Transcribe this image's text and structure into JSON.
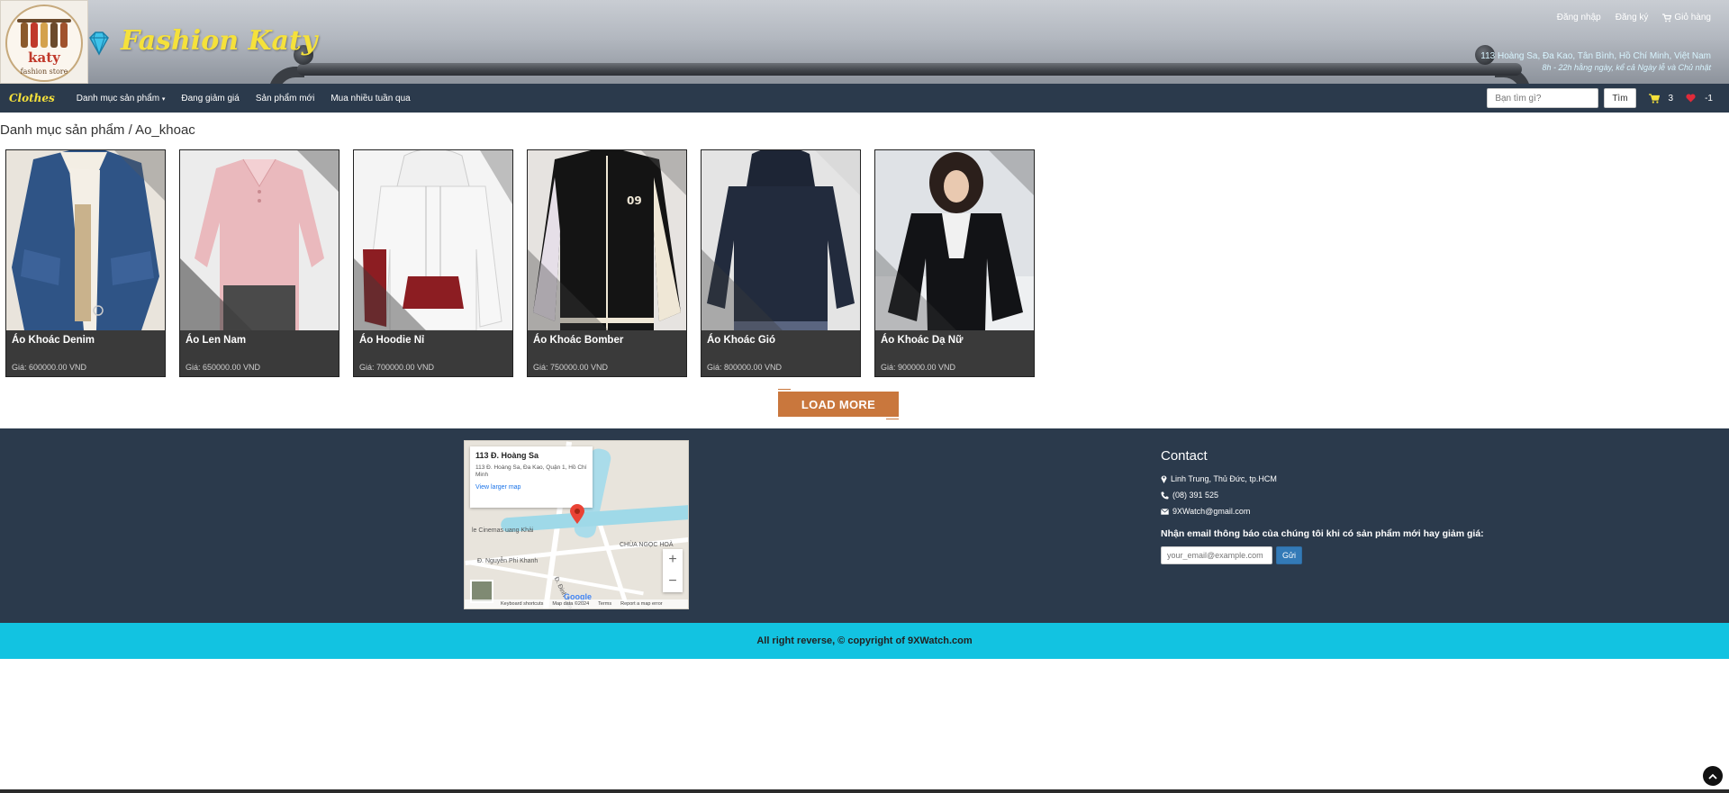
{
  "header": {
    "logo_word": "katy",
    "logo_sub": "fashion store",
    "brand_name": "Fashion Katy",
    "links": {
      "login": "Đăng nhập",
      "register": "Đăng ký",
      "cart": "Giỏ hàng"
    },
    "address": "113 Hoàng Sa, Đa Kao, Tân Bình, Hồ Chí Minh, Việt Nam",
    "hours": "8h - 22h hằng ngày, kể cả Ngày lễ và Chủ nhật"
  },
  "navbar": {
    "brand": "Clothes",
    "menu": {
      "categories": "Danh mục sản phẩm",
      "discount": "Đang giảm giá",
      "new_products": "Sản phẩm mới",
      "best_sellers": "Mua nhiều tuần qua"
    },
    "search_placeholder": "Bạn tìm gì?",
    "search_button": "Tìm",
    "cart_count": "3",
    "wishlist_count": "-1"
  },
  "breadcrumb": "Danh mục sản phẩm / Ao_khoac",
  "products": [
    {
      "name": "Áo Khoác Denim",
      "price": "Giá: 600000.00 VND"
    },
    {
      "name": "Áo Len Nam",
      "price": "Giá: 650000.00 VND"
    },
    {
      "name": "Áo Hoodie Nỉ",
      "price": "Giá: 700000.00 VND"
    },
    {
      "name": "Áo Khoác Bomber",
      "price": "Giá: 750000.00 VND"
    },
    {
      "name": "Áo Khoác Gió",
      "price": "Giá: 800000.00 VND"
    },
    {
      "name": "Áo Khoác Dạ Nữ",
      "price": "Giá: 900000.00 VND"
    }
  ],
  "load_more": "LOAD MORE",
  "map": {
    "place_title": "113 Đ. Hoàng Sa",
    "place_address": "113 Đ. Hoàng Sa, Đa Kao, Quận 1, Hồ Chí Minh",
    "view_larger": "View larger map",
    "label_cinema": "le Cinemas uang Khải",
    "label_street1": "Đ. Nguyễn Phi Khanh",
    "label_pagoda": "CHÙA NGỌC HOÀ",
    "label_street2": "Đ. Đinh Tiên Hoàng",
    "google": "Google",
    "attrib_shortcuts": "Keyboard shortcuts",
    "attrib_data": "Map data ©2024",
    "attrib_terms": "Terms",
    "attrib_report": "Report a map error"
  },
  "contact": {
    "title": "Contact",
    "address": "Linh Trung, Thủ Đức, tp.HCM",
    "phone": "(08) 391 525",
    "email": "9XWatch@gmail.com",
    "newsletter": "Nhận email thông báo của chúng tôi khi có sản phẩm mới hay giảm giá:",
    "email_placeholder": "your_email@example.com",
    "send_button": "Gửi"
  },
  "copyright": "All right reverse, © copyright of 9XWatch.com",
  "colors": {
    "navbar": "#2b3a4c",
    "brand_yellow": "#f5e13b",
    "load_more": "#c9773d",
    "copyright_bar": "#12c3e1",
    "send_button": "#337ab7"
  }
}
